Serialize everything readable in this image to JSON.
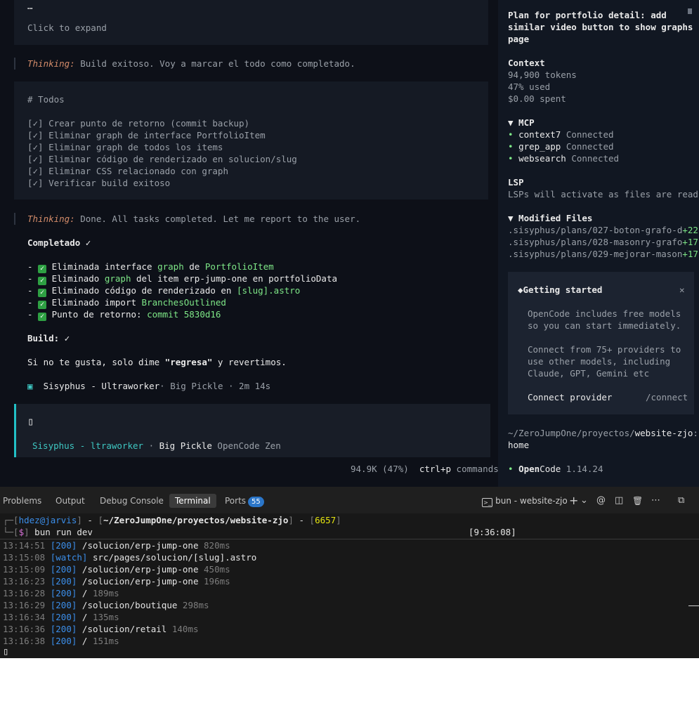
{
  "chat": {
    "ellipsis": "…",
    "click_to_expand": "Click to expand",
    "thinking1_label": "Thinking:",
    "thinking1_text": " Build exitoso. Voy a marcar el todo como completado.",
    "todos_title": "# Todos",
    "todos": [
      "[✓] Crear punto de retorno (commit backup)",
      "[✓] Eliminar graph de interface PortfolioItem",
      "[✓] Eliminar graph de todos los items",
      "[✓] Eliminar código de renderizado en solucion/slug",
      "[✓] Eliminar CSS relacionado con graph",
      "[✓] Verificar build exitoso"
    ],
    "thinking2_label": "Thinking:",
    "thinking2_text": " Done. All tasks completed. Let me report to the user.",
    "completed_title": "Completado ✓",
    "items": [
      {
        "pre": "- ",
        "a": " Eliminada interface ",
        "b": "graph",
        "c": " de ",
        "d": "PortfolioItem"
      },
      {
        "pre": "- ",
        "a": " Eliminado ",
        "b": "graph",
        "c": " del item erp-jump-one en portfolioData",
        "d": ""
      },
      {
        "pre": "- ",
        "a": " Eliminado código de renderizado en ",
        "b": "[slug].astro",
        "c": "",
        "d": ""
      },
      {
        "pre": "- ",
        "a": " Eliminado import ",
        "b": "BranchesOutlined",
        "c": "",
        "d": ""
      },
      {
        "pre": "- ",
        "a": " Punto de retorno: ",
        "b": "commit 5830d16",
        "c": "",
        "d": ""
      }
    ],
    "build_label": "Build:",
    "build_value": " ✓",
    "regresa_pre": "Si no te gusta, solo dime ",
    "regresa_word": "\"regresa\"",
    "regresa_post": " y revertimos.",
    "agent_icon": "▣",
    "agent_name": "Sisyphus - Ultraworker",
    "agent_meta": "· Big Pickle · 2m 14s",
    "input_cursor": "▯",
    "input_agent": "Sisyphus - ltraworker",
    "input_dot": " · ",
    "input_model": "Big Pickle",
    "input_provider": " OpenCode Zen",
    "footer_tokens": "94.9K (47%)",
    "footer_shortcut": "ctrl+p",
    "footer_commands": " commands"
  },
  "sidebar": {
    "title_lines": [
      "Plan for portfolio detail: add",
      "similar video button to show graphs",
      "page"
    ],
    "context_title": "Context",
    "context_lines": [
      "94,900 tokens",
      "47% used",
      "$0.00 spent"
    ],
    "mcp_title": "▼ MCP",
    "mcp": [
      {
        "name": "context7",
        "status": "Connected"
      },
      {
        "name": "grep_app",
        "status": "Connected"
      },
      {
        "name": "websearch",
        "status": "Connected"
      }
    ],
    "lsp_title": "LSP",
    "lsp_text": "LSPs will activate as files are read",
    "modified_title": "▼ Modified Files",
    "modified": [
      {
        "path": ".sisyphus/plans/027-boton-grafo-d",
        "delta": "+22"
      },
      {
        "path": ".sisyphus/plans/028-masonry-grafo",
        "delta": "+17"
      },
      {
        "path": ".sisyphus/plans/029-mejorar-mason",
        "delta": "+17"
      }
    ],
    "getting_started": {
      "icon": "◆",
      "title": "Getting started",
      "close": "✕",
      "p1": [
        "OpenCode includes free models",
        "so you can start immediately."
      ],
      "p2": [
        "Connect from 75+ providers to",
        "use other models, including",
        "Claude, GPT, Gemini etc"
      ],
      "connect_label": "Connect provider",
      "connect_cmd": "/connect"
    },
    "path_pre": "~/ZeroJumpOne/proyectos/",
    "path_bold": "website-zjo",
    "path_post": ":",
    "path_line2": "home",
    "version_dot": "•",
    "version_open": "Open",
    "version_code": "Code",
    "version_num": " 1.14.24"
  },
  "panel": {
    "tabs": [
      "Problems",
      "Output",
      "Debug Console",
      "Terminal",
      "Ports"
    ],
    "ports_badge": "55",
    "terminal_name": "bun - website-zjo",
    "icons": {
      "plus": "+",
      "chevron": "⌄",
      "at": "@",
      "split": "◫",
      "trash": "🗑",
      "more": "⋯",
      "maximize": "⧉"
    }
  },
  "terminal": {
    "prompt_user": "hdez@jarvis",
    "prompt_path": "~/ZeroJumpOne/proyectos/website-zjo",
    "prompt_num": "6657",
    "prompt_time": "[9:36:08]",
    "prompt_sym": "$",
    "command": " bun run dev",
    "logs": [
      {
        "time": "13:14:51",
        "tag": "[200]",
        "path": "/solucion/erp-jump-one",
        "ms": "820ms"
      },
      {
        "time": "13:15:08",
        "tag": "[watch]",
        "path": "src/pages/solucion/[slug].astro",
        "ms": ""
      },
      {
        "time": "13:15:09",
        "tag": "[200]",
        "path": "/solucion/erp-jump-one",
        "ms": "450ms"
      },
      {
        "time": "13:16:23",
        "tag": "[200]",
        "path": "/solucion/erp-jump-one",
        "ms": "196ms"
      },
      {
        "time": "13:16:28",
        "tag": "[200]",
        "path": "/",
        "ms": "189ms"
      },
      {
        "time": "13:16:29",
        "tag": "[200]",
        "path": "/solucion/boutique",
        "ms": "298ms"
      },
      {
        "time": "13:16:34",
        "tag": "[200]",
        "path": "/",
        "ms": "135ms"
      },
      {
        "time": "13:16:36",
        "tag": "[200]",
        "path": "/solucion/retail",
        "ms": "140ms"
      },
      {
        "time": "13:16:38",
        "tag": "[200]",
        "path": "/",
        "ms": "151ms"
      }
    ],
    "cursor": "▯"
  }
}
